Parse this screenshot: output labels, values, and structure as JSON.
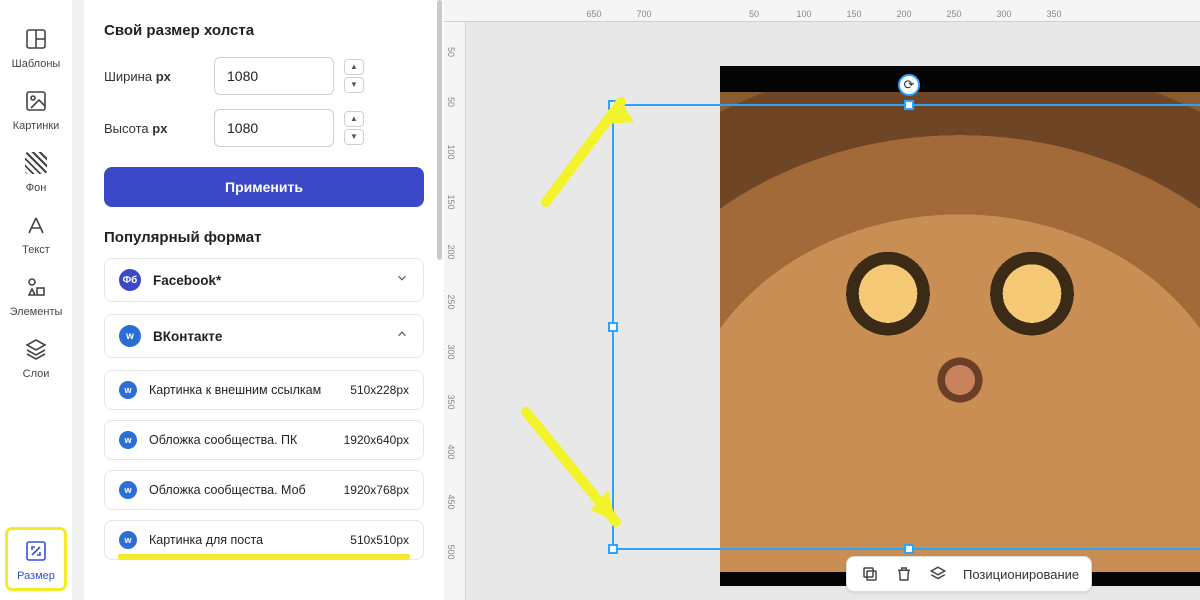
{
  "rail": {
    "items": [
      {
        "label": "Шаблоны"
      },
      {
        "label": "Картинки"
      },
      {
        "label": "Фон"
      },
      {
        "label": "Текст"
      },
      {
        "label": "Элементы"
      },
      {
        "label": "Слои"
      },
      {
        "label": "Размер"
      }
    ]
  },
  "panel": {
    "custom_title": "Свой размер холста",
    "width_label": "Ширина",
    "height_label": "Высота",
    "unit": "px",
    "width_value": "1080",
    "height_value": "1080",
    "apply": "Применить",
    "popular_title": "Популярный формат",
    "accordions": [
      {
        "badge": "Фб",
        "badge_class": "fb",
        "label": "Facebook*",
        "open": false
      },
      {
        "badge": "w",
        "badge_class": "vk",
        "label": "ВКонтакте",
        "open": true
      }
    ],
    "presets": [
      {
        "label": "Картинка к внешним ссылкам",
        "dim": "510x228px"
      },
      {
        "label": "Обложка сообщества. ПК",
        "dim": "1920x640px"
      },
      {
        "label": "Обложка сообщества. Моб",
        "dim": "1920x768px"
      },
      {
        "label": "Картинка для поста",
        "dim": "510x510px"
      }
    ]
  },
  "ruler_h": [
    "650",
    "700",
    "50",
    "100",
    "150",
    "200",
    "250",
    "300",
    "350"
  ],
  "ruler_v": [
    "50",
    "50",
    "100",
    "150",
    "200",
    "250",
    "300",
    "350",
    "400",
    "450",
    "500"
  ],
  "bottom_bar": {
    "positioning": "Позиционирование"
  }
}
